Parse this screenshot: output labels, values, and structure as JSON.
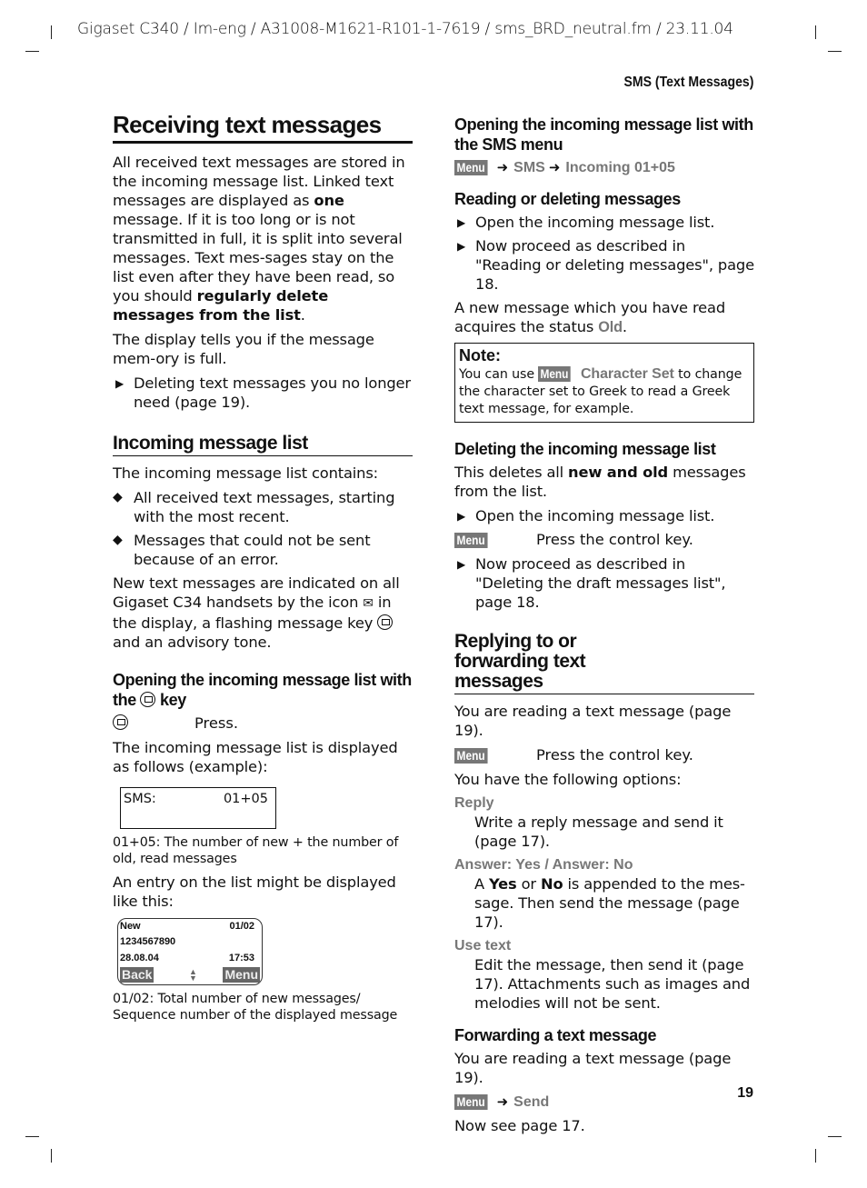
{
  "page": {
    "header": "Gigaset C340 / Im-eng / A31008-M1621-R101-1-7619 / sms_BRD_neutral.fm / 23.11.04",
    "section": "SMS (Text Messages)",
    "number": "19"
  },
  "left": {
    "title": "Receiving text messages",
    "intro": {
      "p1_a": "All received text messages are stored in the incoming message list. Linked text messages are displayed as ",
      "p1_b": "one",
      "p1_c": " message. If it is too long or is not transmitted in full, it is split into several messages. Text mes-sages stay on the list even after they have been read, so you should ",
      "p1_d": "regularly delete messages from the list",
      "p1_e": ".",
      "p2": "The display tells you if the message mem-ory is full.",
      "bullet": "Deleting text messages you no longer need (page 19)."
    },
    "incoming": {
      "title": "Incoming message list",
      "lead": "The incoming message list contains:",
      "items": [
        "All received text messages, starting with the most recent.",
        "Messages that could not be sent because of an error."
      ],
      "p_a": "New text messages are indicated on all Gigaset C34 handsets by the icon ",
      "p_b": " in the display, a flashing message key ",
      "p_c": " and an advisory tone."
    },
    "open_key": {
      "title_a": "Opening the incoming message list with the ",
      "title_b": " key",
      "press": "Press.",
      "p1": "The incoming message list is displayed as follows (example):",
      "display": {
        "label": "SMS:",
        "value": "01+05"
      },
      "caption1": "01+05: The number of new + the number of old, read messages",
      "p2": "An entry on the list might be displayed like this:",
      "entry": {
        "status": "New",
        "counter": "01/02",
        "number": "1234567890",
        "date": "28.08.04",
        "time": "17:53",
        "left_softkey": "Back",
        "right_softkey": "Menu"
      },
      "caption2": "01/02: Total number of new messages/ Sequence number of the displayed message"
    }
  },
  "right": {
    "open_menu": {
      "title": "Opening the incoming message list with the SMS menu",
      "path": [
        "Menu",
        "SMS",
        "Incoming 01+05"
      ]
    },
    "reading": {
      "title": "Reading or deleting messages",
      "items": [
        "Open the incoming message list.",
        "Now proceed as described in \"Reading or deleting messages\", page 18."
      ],
      "p_a": "A new message which you have read acquires the status ",
      "p_status": "Old",
      "p_b": "."
    },
    "note": {
      "title": "Note:",
      "a": "You can use ",
      "menu": "Menu",
      "option": "Character Set",
      "b": " to change the character set to Greek to read a Greek text message, for example."
    },
    "deleting": {
      "title": "Deleting the incoming message list",
      "p_a": "This deletes all ",
      "p_b": "new and old",
      "p_c": " messages from the list.",
      "item1": "Open the incoming message list.",
      "key": "Menu",
      "key_text": "Press the control key.",
      "item2": "Now proceed as described in \"Deleting the draft messages list\", page 18."
    },
    "replying": {
      "title": "Replying to or forwarding text messages",
      "p1": "You are reading a text message (page 19).",
      "key": "Menu",
      "key_text": "Press the control key.",
      "p2": "You have the following options:",
      "options": [
        {
          "label": "Reply",
          "text": "Write a reply message and send it (page 17)."
        },
        {
          "label": "Answer: Yes / Answer: No"
        },
        {
          "label": "Use text",
          "text": "Edit the message, then send it (page 17). Attachments such as images and melodies will not be sent."
        }
      ],
      "answer_text": {
        "a": "A ",
        "yes": "Yes",
        "or": " or ",
        "no": "No",
        "b": " is appended to the mes-sage. Then send the message (page 17)."
      }
    },
    "forwarding": {
      "title": "Forwarding a text message",
      "p1": "You are reading a text message (page 19).",
      "path": [
        "Menu",
        "Send"
      ],
      "p2": "Now see page 17."
    }
  }
}
